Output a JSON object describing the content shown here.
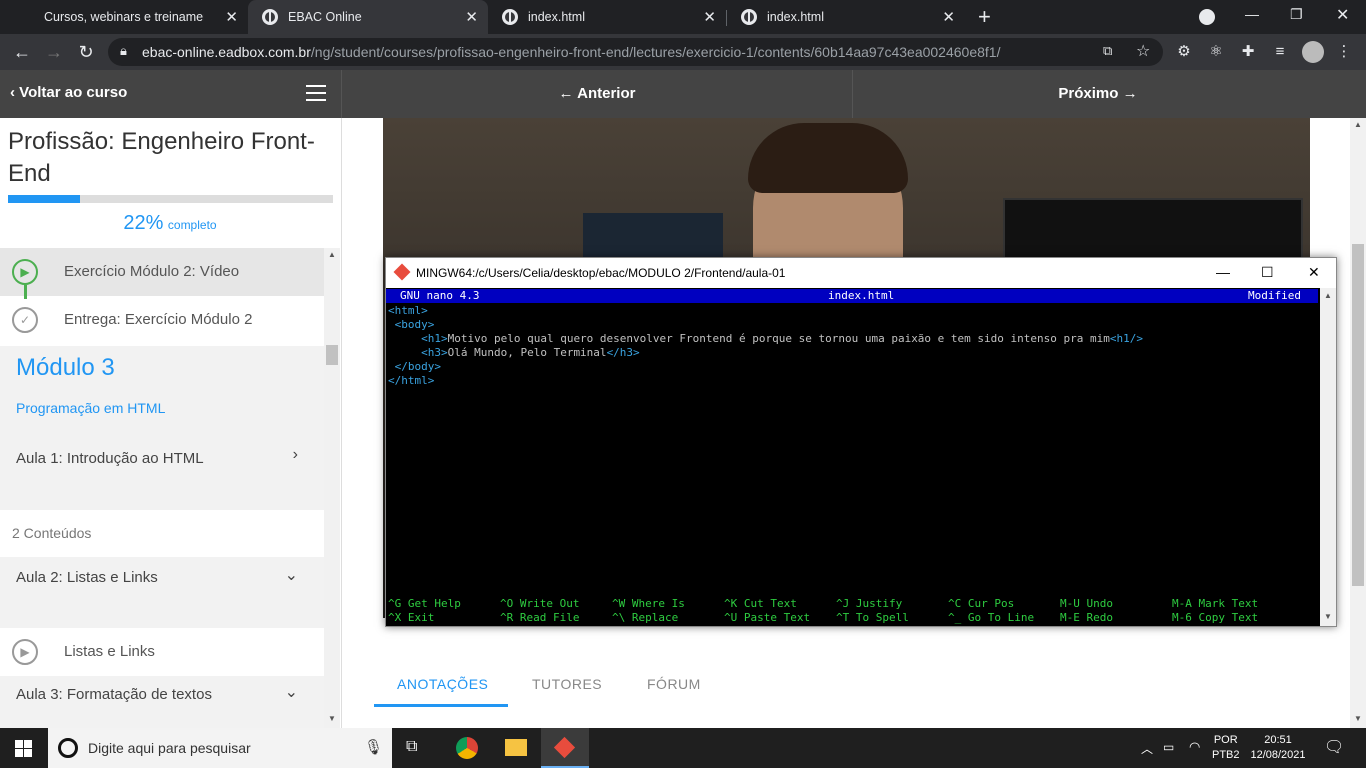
{
  "browser": {
    "tabs": [
      {
        "title": "Cursos, webinars e treinamento p"
      },
      {
        "title": "EBAC Online"
      },
      {
        "title": "index.html"
      },
      {
        "title": "index.html"
      }
    ],
    "url_host": "ebac-online.eadbox.com.br",
    "url_path": "/ng/student/courses/profissao-engenheiro-front-end/lectures/exercicio-1/contents/60b14aa97c43ea002460e8f1/"
  },
  "coursebar": {
    "back_label": "Voltar ao curso",
    "prev_label": "Anterior",
    "next_label": "Próximo"
  },
  "sidebar": {
    "course_title": "Profissão: Engenheiro Front-End",
    "progress_percent": 22,
    "progress_label": "22%",
    "progress_suffix": "completo",
    "lessons": [
      {
        "label": "Exercício Módulo 2: Vídeo"
      },
      {
        "label": "Entrega: Exercício Módulo 2"
      }
    ],
    "module": {
      "title": "Módulo 3",
      "subtitle": "Programação em HTML"
    },
    "aula1": "Aula 1: Introdução ao HTML",
    "contents_count": "2 Conteúdos",
    "aula2": "Aula 2: Listas e Links",
    "aula2_item": "Listas e Links",
    "aula3": "Aula 3: Formatação de textos"
  },
  "content_tabs": [
    "ANOTAÇÕES",
    "TUTORES",
    "FÓRUM"
  ],
  "terminal": {
    "title": "MINGW64:/c/Users/Celia/desktop/ebac/MODULO 2/Frontend/aula-01",
    "nano_version": "GNU nano 4.3",
    "filename": "index.html",
    "status": "Modified",
    "lines": [
      {
        "open": "<html>",
        "text": "",
        "close": ""
      },
      {
        "open": " <body>",
        "text": "",
        "close": ""
      },
      {
        "open": "     <h1>",
        "text": "Motivo pelo qual quero desenvolver Frontend é porque se tornou uma paixão e tem sido intenso pra mim",
        "close": "<h1/>"
      },
      {
        "open": "     <h3>",
        "text": "Olá Mundo, Pelo Terminal",
        "close": "</h3>"
      },
      {
        "open": " </body>",
        "text": "",
        "close": ""
      },
      {
        "open": "</html>",
        "text": "",
        "close": ""
      }
    ],
    "shortcuts_row1": [
      "^G Get Help",
      "^O Write Out",
      "^W Where Is",
      "^K Cut Text",
      "^J Justify",
      "^C Cur Pos",
      "M-U Undo",
      "M-A Mark Text"
    ],
    "shortcuts_row2": [
      "^X Exit",
      "^R Read File",
      "^\\ Replace",
      "^U Paste Text",
      "^T To Spell",
      "^_ Go To Line",
      "M-E Redo",
      "M-6 Copy Text"
    ]
  },
  "taskbar": {
    "search_placeholder": "Digite aqui para pesquisar",
    "lang_top": "POR",
    "lang_bottom": "PTB2",
    "time": "20:51",
    "date": "12/08/2021"
  },
  "colors": {
    "accent": "#2196f3",
    "nano_bar": "#0000c0",
    "nano_shortcut": "#2ecc40"
  }
}
